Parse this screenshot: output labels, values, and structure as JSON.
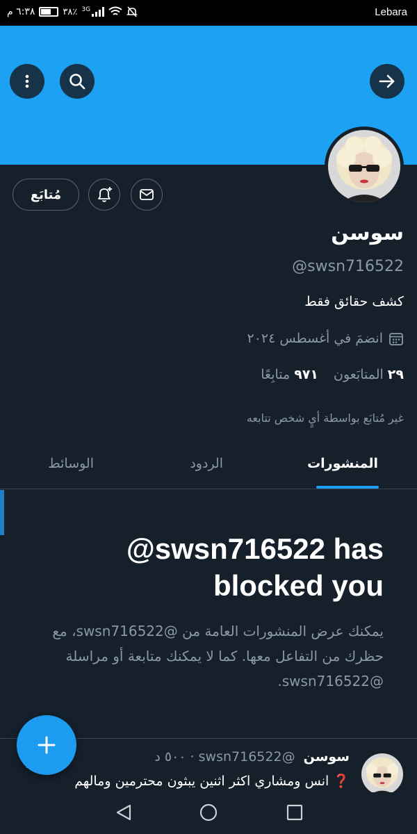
{
  "status_bar": {
    "carrier": "Lebara",
    "time": "٦:٣٨ م",
    "battery": "٣٨٪",
    "network": "3G"
  },
  "profile": {
    "display_name": "سوسن",
    "handle": "@swsn716522",
    "bio": "كشف حقائق فقط",
    "joined": "انضمَ في أغسطس ٢٠٢٤",
    "following_count": "٩٧١",
    "following_label": "متابِعًا",
    "followers_count": "٢٩",
    "followers_label": "المتابَعون",
    "followed_by": "غير مُتابَع بواسطة أيٍ شخص تتابعه"
  },
  "actions": {
    "follow_label": "مُتابَع"
  },
  "tabs": [
    {
      "label": "المنشورات",
      "active": true
    },
    {
      "label": "الردود",
      "active": false
    },
    {
      "label": "الوسائط",
      "active": false
    }
  ],
  "blocked": {
    "title": "@swsn716522 has blocked you",
    "description": "يمكنك عرض المنشورات العامة من @swsn716522، مع حظرك من التفاعل معها. كما لا يمكنك متابعة أو مراسلة @swsn716522."
  },
  "post": {
    "name": "سوسن",
    "handle": "@swsn716522",
    "time": "٥٠٠ د",
    "text": "❓ انس ومشاري اكثر اثنين يبثون محترمين ومالهم"
  },
  "icons": {
    "menu": "more-vertical-icon",
    "search": "search-icon",
    "forward": "arrow-right-icon",
    "notify": "bell-plus-icon",
    "message": "mail-icon",
    "calendar": "calendar-icon",
    "compose": "plus-icon"
  },
  "colors": {
    "banner": "#1da1f2",
    "background": "#15202b",
    "accent": "#1d9bf0",
    "muted_text": "#8b98a5"
  }
}
